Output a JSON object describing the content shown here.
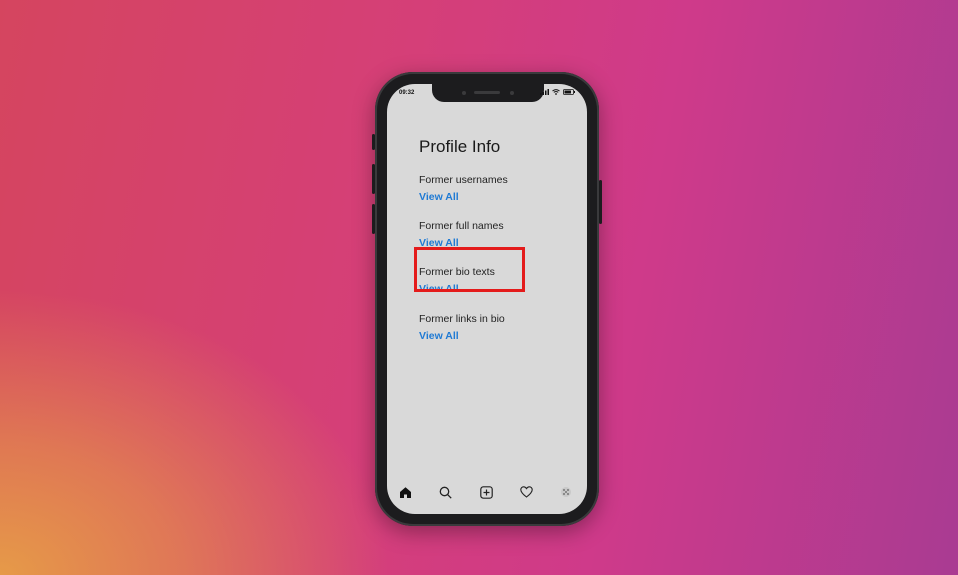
{
  "status_bar": {
    "time": "09:32"
  },
  "page": {
    "title": "Profile Info"
  },
  "sections": [
    {
      "label": "Former usernames",
      "link": "View All"
    },
    {
      "label": "Former full names",
      "link": "View All"
    },
    {
      "label": "Former bio texts",
      "link": "View All",
      "highlighted": true
    },
    {
      "label": "Former links in bio",
      "link": "View All"
    }
  ],
  "tab_bar": {
    "icons": [
      "home-icon",
      "search-icon",
      "add-post-icon",
      "heart-icon",
      "profile-icon"
    ]
  },
  "colors": {
    "link": "#1f7ad4",
    "highlight": "#e41b1b",
    "screen_bg": "#d9d9d9"
  }
}
